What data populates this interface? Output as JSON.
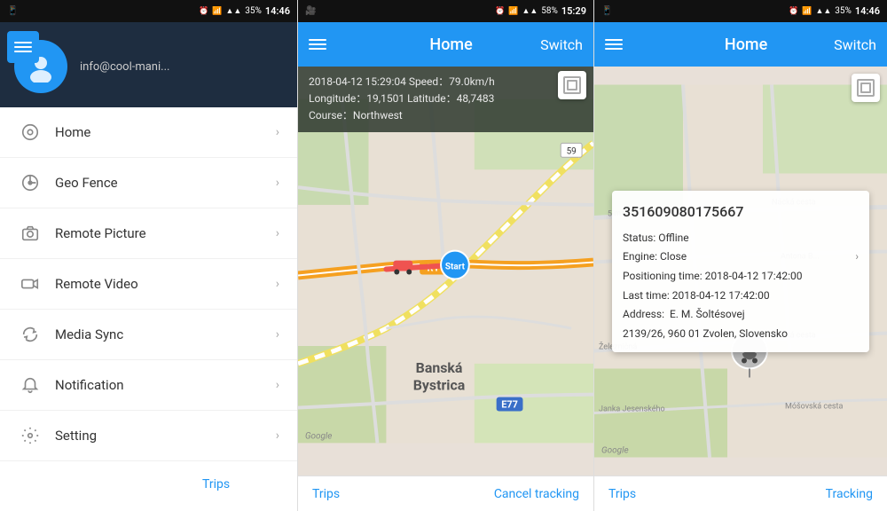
{
  "panel1": {
    "status_bar": {
      "left_icon": "☰",
      "battery": "35%",
      "time": "14:46"
    },
    "profile": {
      "email": "info@cool-mani..."
    },
    "menu_items": [
      {
        "id": "home",
        "label": "Home",
        "icon": "location"
      },
      {
        "id": "geo_fence",
        "label": "Geo Fence",
        "icon": "fence"
      },
      {
        "id": "remote_picture",
        "label": "Remote Picture",
        "icon": "camera"
      },
      {
        "id": "remote_video",
        "label": "Remote Video",
        "icon": "video"
      },
      {
        "id": "media_sync",
        "label": "Media Sync",
        "icon": "sync"
      },
      {
        "id": "notification",
        "label": "Notification",
        "icon": "bell"
      },
      {
        "id": "setting",
        "label": "Setting",
        "icon": "settings"
      }
    ],
    "trips_label": "Trips"
  },
  "panel2": {
    "status_bar": {
      "battery": "58%",
      "time": "15:29"
    },
    "app_bar": {
      "title": "Home",
      "switch_label": "Switch"
    },
    "trip_info": {
      "line1": "2018-04-12 15:29:04  Speed：79.0km/h",
      "line2": "Longitude：19,1501  Latitude：48,7483",
      "line3": "Course：Northwest"
    },
    "bottom": {
      "trips": "Trips",
      "cancel_tracking": "Cancel tracking"
    },
    "map_city": "Banská\nBystrica",
    "google_label": "Google"
  },
  "panel3": {
    "status_bar": {
      "battery": "35%",
      "time": "14:46"
    },
    "app_bar": {
      "title": "Home",
      "switch_label": "Switch"
    },
    "tracker": {
      "id": "351609080175667",
      "status_label": "Status:",
      "status_value": "Offline",
      "engine_label": "Engine:",
      "engine_value": "Close",
      "positioning_label": "Positioning time:",
      "positioning_value": "2018-04-12 17:42:00",
      "last_time_label": "Last time:",
      "last_time_value": "2018-04-12 17:42:00",
      "address_label": "Address:",
      "address_value": "E. M. Šoltésovej\n2139/26, 960 01 Zvolen, Slovensko"
    },
    "bottom": {
      "trips": "Trips",
      "tracking": "Tracking"
    },
    "google_label": "Google"
  }
}
